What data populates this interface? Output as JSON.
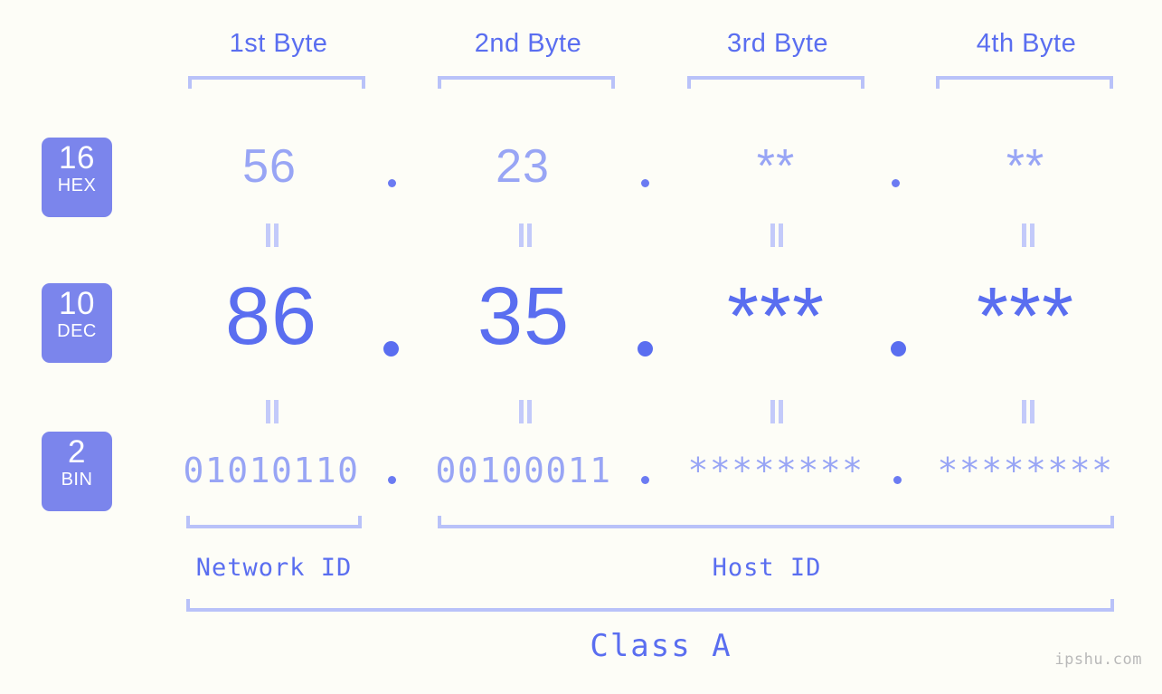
{
  "page": {
    "background_color": "#fdfdf7",
    "accent_color": "#5a6ef0",
    "badge_color": "#7b85ec",
    "muted_color": "#98a5f5",
    "bracket_color": "#b9c2f9"
  },
  "byte_headers": [
    {
      "label": "1st Byte"
    },
    {
      "label": "2nd Byte"
    },
    {
      "label": "3rd Byte"
    },
    {
      "label": "4th Byte"
    }
  ],
  "rows": [
    {
      "badge_number": "16",
      "badge_name": "HEX",
      "values": [
        "56",
        "23",
        "**",
        "**"
      ]
    },
    {
      "badge_number": "10",
      "badge_name": "DEC",
      "values": [
        "86",
        "35",
        "***",
        "***"
      ]
    },
    {
      "badge_number": "2",
      "badge_name": "BIN",
      "values": [
        "01010110",
        "00100011",
        "********",
        "********"
      ]
    }
  ],
  "separators": {
    "dot": ".",
    "equals": "="
  },
  "sections": {
    "network_id": "Network ID",
    "host_id": "Host ID",
    "class": "Class A"
  },
  "watermark": "ipshu.com"
}
